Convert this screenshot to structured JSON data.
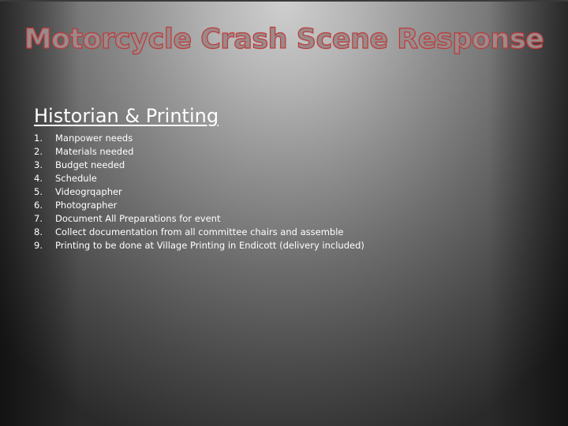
{
  "slide": {
    "title": "Motorcycle Crash Scene Response",
    "subtitle": "Historian & Printing",
    "items": [
      {
        "number": "1.",
        "text": "Manpower needs"
      },
      {
        "number": "2.",
        "text": "Materials needed"
      },
      {
        "number": "3.",
        "text": "Budget needed"
      },
      {
        "number": "4.",
        "text": "Schedule"
      },
      {
        "number": "5.",
        "text": "Videogrqapher"
      },
      {
        "number": "6.",
        "text": "Photographer"
      },
      {
        "number": "7.",
        "text": "Document All Preparations for event"
      },
      {
        "number": "8.",
        "text": "Collect documentation from all committee chairs and assemble"
      },
      {
        "number": "9.",
        "text": "Printing to be done at Village Printing in Endicott (delivery included)"
      }
    ]
  },
  "colors": {
    "title_fill": "#9a8a8a",
    "title_outline": "#c03a3a",
    "body_text": "#ffffff",
    "background_light": "#cfcfcf",
    "background_dark": "#1a1a1a"
  }
}
